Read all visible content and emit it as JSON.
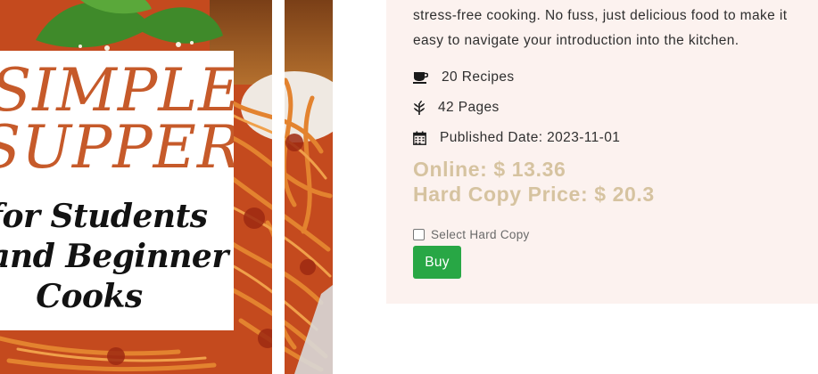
{
  "product": {
    "description_lines": [
      "stress-free cooking. No fuss, just delicious food to make it",
      "easy to navigate your introduction into the kitchen."
    ],
    "meta": {
      "recipes": {
        "icon": "coffee-cup-icon",
        "text": "20 Recipes"
      },
      "pages": {
        "icon": "leaf-icon",
        "text": "42 Pages"
      },
      "published": {
        "icon": "calendar-icon",
        "text": "Published Date: 2023-11-01"
      }
    },
    "price_online": "Online: $ 13.36",
    "price_hard_copy": "Hard Copy Price: $ 20.3",
    "hard_copy_checkbox_label": "Select Hard Copy",
    "hard_copy_checked": false,
    "buy_label": "Buy"
  },
  "cover": {
    "title_line1": "SIMPLE",
    "title_line2": "SUPPERS",
    "subtitle_line1": "for Students",
    "subtitle_line2": "and Beginner",
    "subtitle_line3": "Cooks"
  },
  "colors": {
    "panel_bg": "#fcf2ef",
    "price": "#d6c3a0",
    "buy_button": "#28a745",
    "cover_title": "#c65a2a"
  }
}
